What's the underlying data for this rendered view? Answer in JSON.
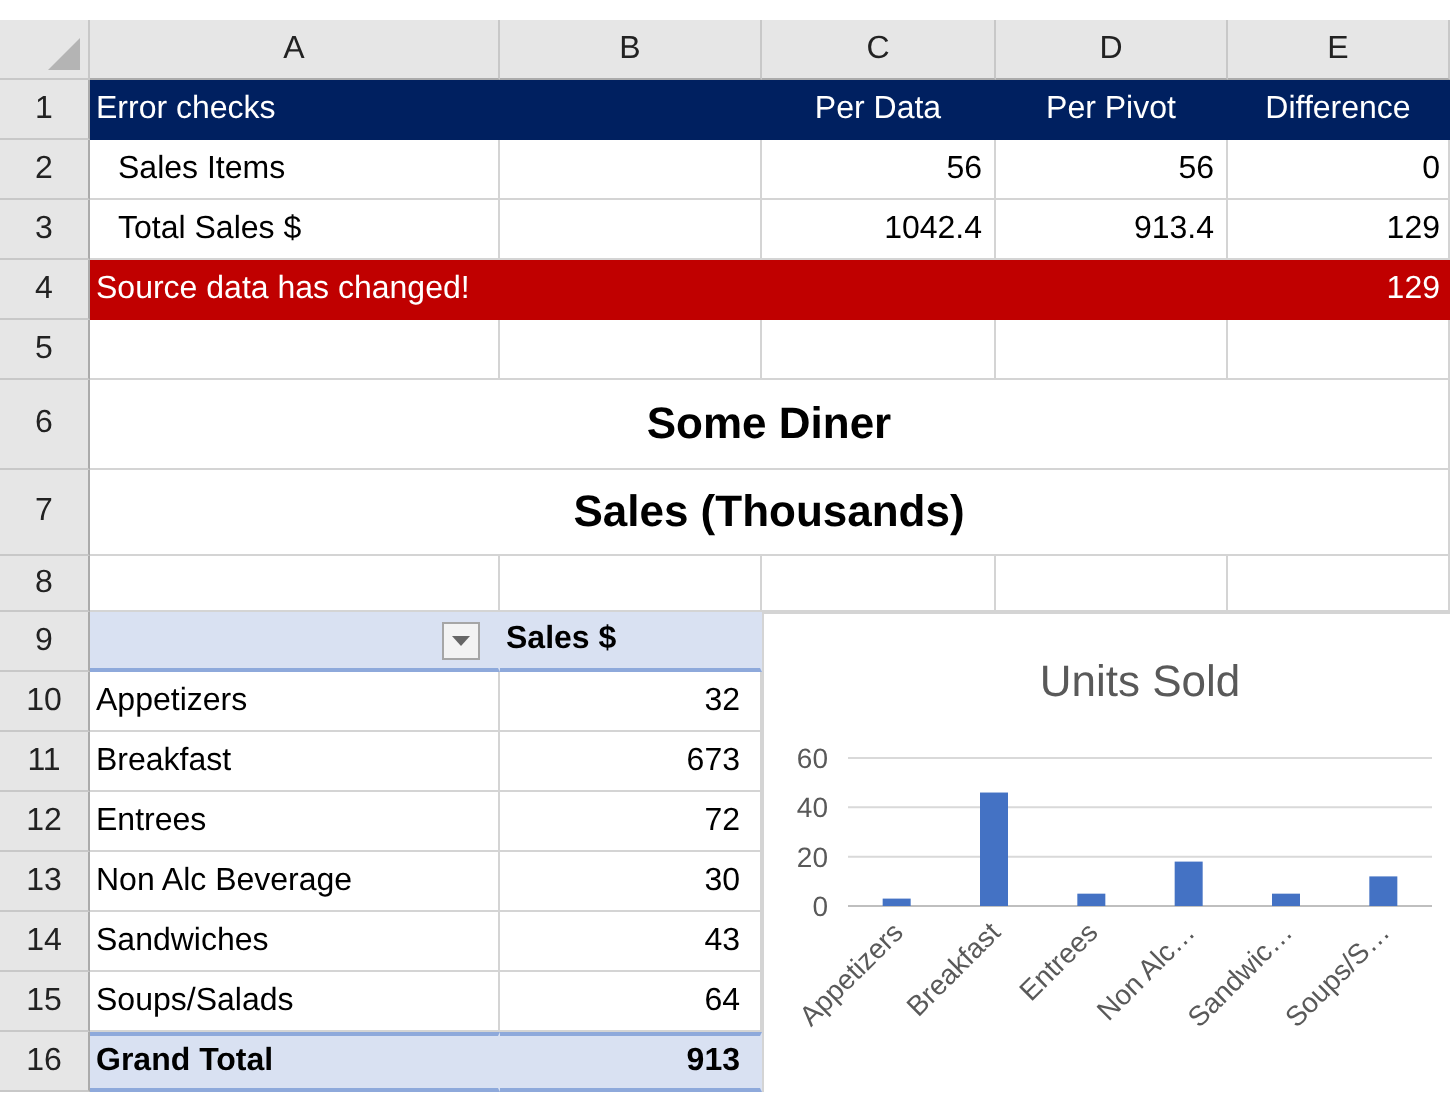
{
  "column_headers": [
    "A",
    "B",
    "C",
    "D",
    "E"
  ],
  "row_headers": [
    "1",
    "2",
    "3",
    "4",
    "5",
    "6",
    "7",
    "8",
    "9",
    "10",
    "11",
    "12",
    "13",
    "14",
    "15",
    "16"
  ],
  "error_checks": {
    "title": "Error checks",
    "headers": [
      "Per Data",
      "Per Pivot",
      "Difference"
    ],
    "rows": [
      {
        "label": "Sales Items",
        "values": [
          "56",
          "56",
          "0"
        ]
      },
      {
        "label": "Total Sales $",
        "values": [
          "1042.4",
          "913.4",
          "129"
        ]
      }
    ],
    "alert": {
      "message": "Source data has changed!",
      "value": "129"
    }
  },
  "report_title": "Some Diner",
  "report_subtitle": "Sales (Thousands)",
  "pivot": {
    "header": "Sales $",
    "rows": [
      {
        "label": "Appetizers",
        "value": "32"
      },
      {
        "label": "Breakfast",
        "value": "673"
      },
      {
        "label": "Entrees",
        "value": "72"
      },
      {
        "label": "Non Alc Beverage",
        "value": "30"
      },
      {
        "label": "Sandwiches",
        "value": "43"
      },
      {
        "label": "Soups/Salads",
        "value": "64"
      }
    ],
    "total": {
      "label": "Grand Total",
      "value": "913"
    }
  },
  "chart": {
    "chart_data": {
      "type": "bar",
      "title": "Units Sold",
      "categories": [
        "Appetizers",
        "Breakfast",
        "Entrees",
        "Non Alc…",
        "Sandwic…",
        "Soups/S…"
      ],
      "values": [
        3,
        46,
        5,
        18,
        5,
        12
      ],
      "ylim": [
        0,
        60
      ],
      "yticks": [
        0,
        20,
        40,
        60
      ]
    }
  }
}
